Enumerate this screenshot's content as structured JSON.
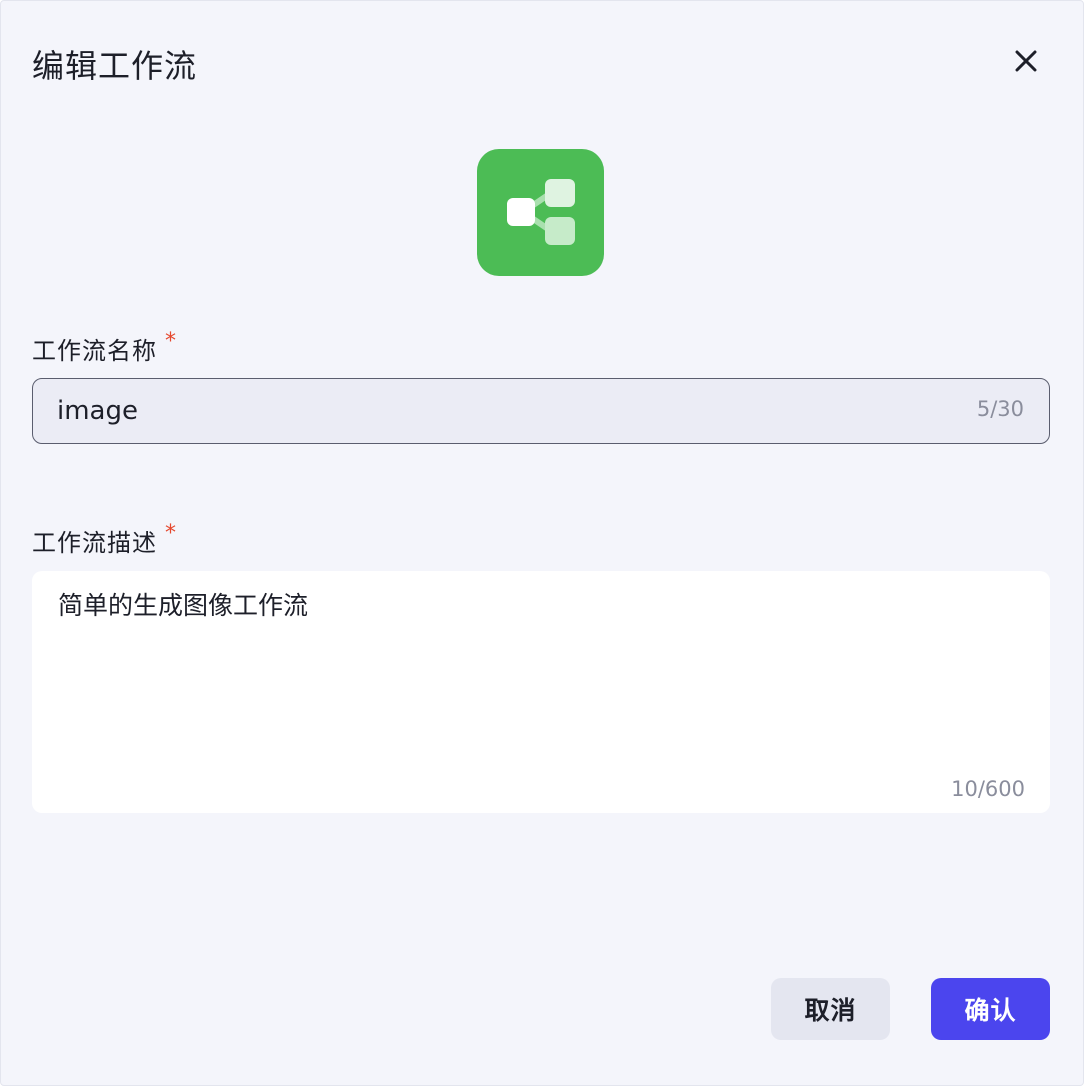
{
  "dialog": {
    "title": "编辑工作流",
    "close_icon": "close-icon"
  },
  "workflow_icon": {
    "name": "workflow-share-icon",
    "color": "#4cbc55"
  },
  "name_field": {
    "label": "工作流名称",
    "required_mark": "*",
    "value": "image",
    "counter": "5/30"
  },
  "description_field": {
    "label": "工作流描述",
    "required_mark": "*",
    "value": "简单的生成图像工作流",
    "counter": "10/600"
  },
  "actions": {
    "cancel_label": "取消",
    "confirm_label": "确认",
    "confirm_color": "#4b45ee"
  }
}
